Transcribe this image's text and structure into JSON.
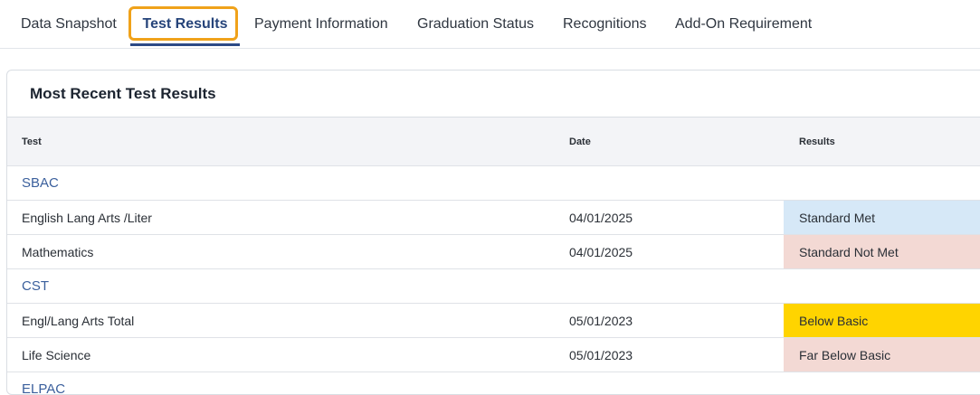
{
  "tabs": [
    {
      "label": "Data Snapshot"
    },
    {
      "label": "Test Results"
    },
    {
      "label": "Payment Information"
    },
    {
      "label": "Graduation Status"
    },
    {
      "label": "Recognitions"
    },
    {
      "label": "Add-On Requirement"
    }
  ],
  "card": {
    "title": "Most Recent Test Results",
    "columns": {
      "test": "Test",
      "date": "Date",
      "results": "Results"
    }
  },
  "groups": [
    {
      "name": "SBAC"
    },
    {
      "name": "CST"
    },
    {
      "name": "ELPAC"
    }
  ],
  "rows": [
    {
      "test": "English Lang Arts /Liter",
      "date": "04/01/2025",
      "result": "Standard Met",
      "color": "#d6e8f7"
    },
    {
      "test": "Mathematics",
      "date": "04/01/2025",
      "result": "Standard Not Met",
      "color": "#f3d9d4"
    },
    {
      "test": "Engl/Lang Arts Total",
      "date": "05/01/2023",
      "result": "Below Basic",
      "color": "#ffd400"
    },
    {
      "test": "Life Science",
      "date": "05/01/2023",
      "result": "Far Below Basic",
      "color": "#f3d9d4"
    }
  ],
  "colors": {
    "accent": "#2c4a86",
    "focus_ring": "#f0a21a",
    "group_link": "#3a5f9c"
  }
}
